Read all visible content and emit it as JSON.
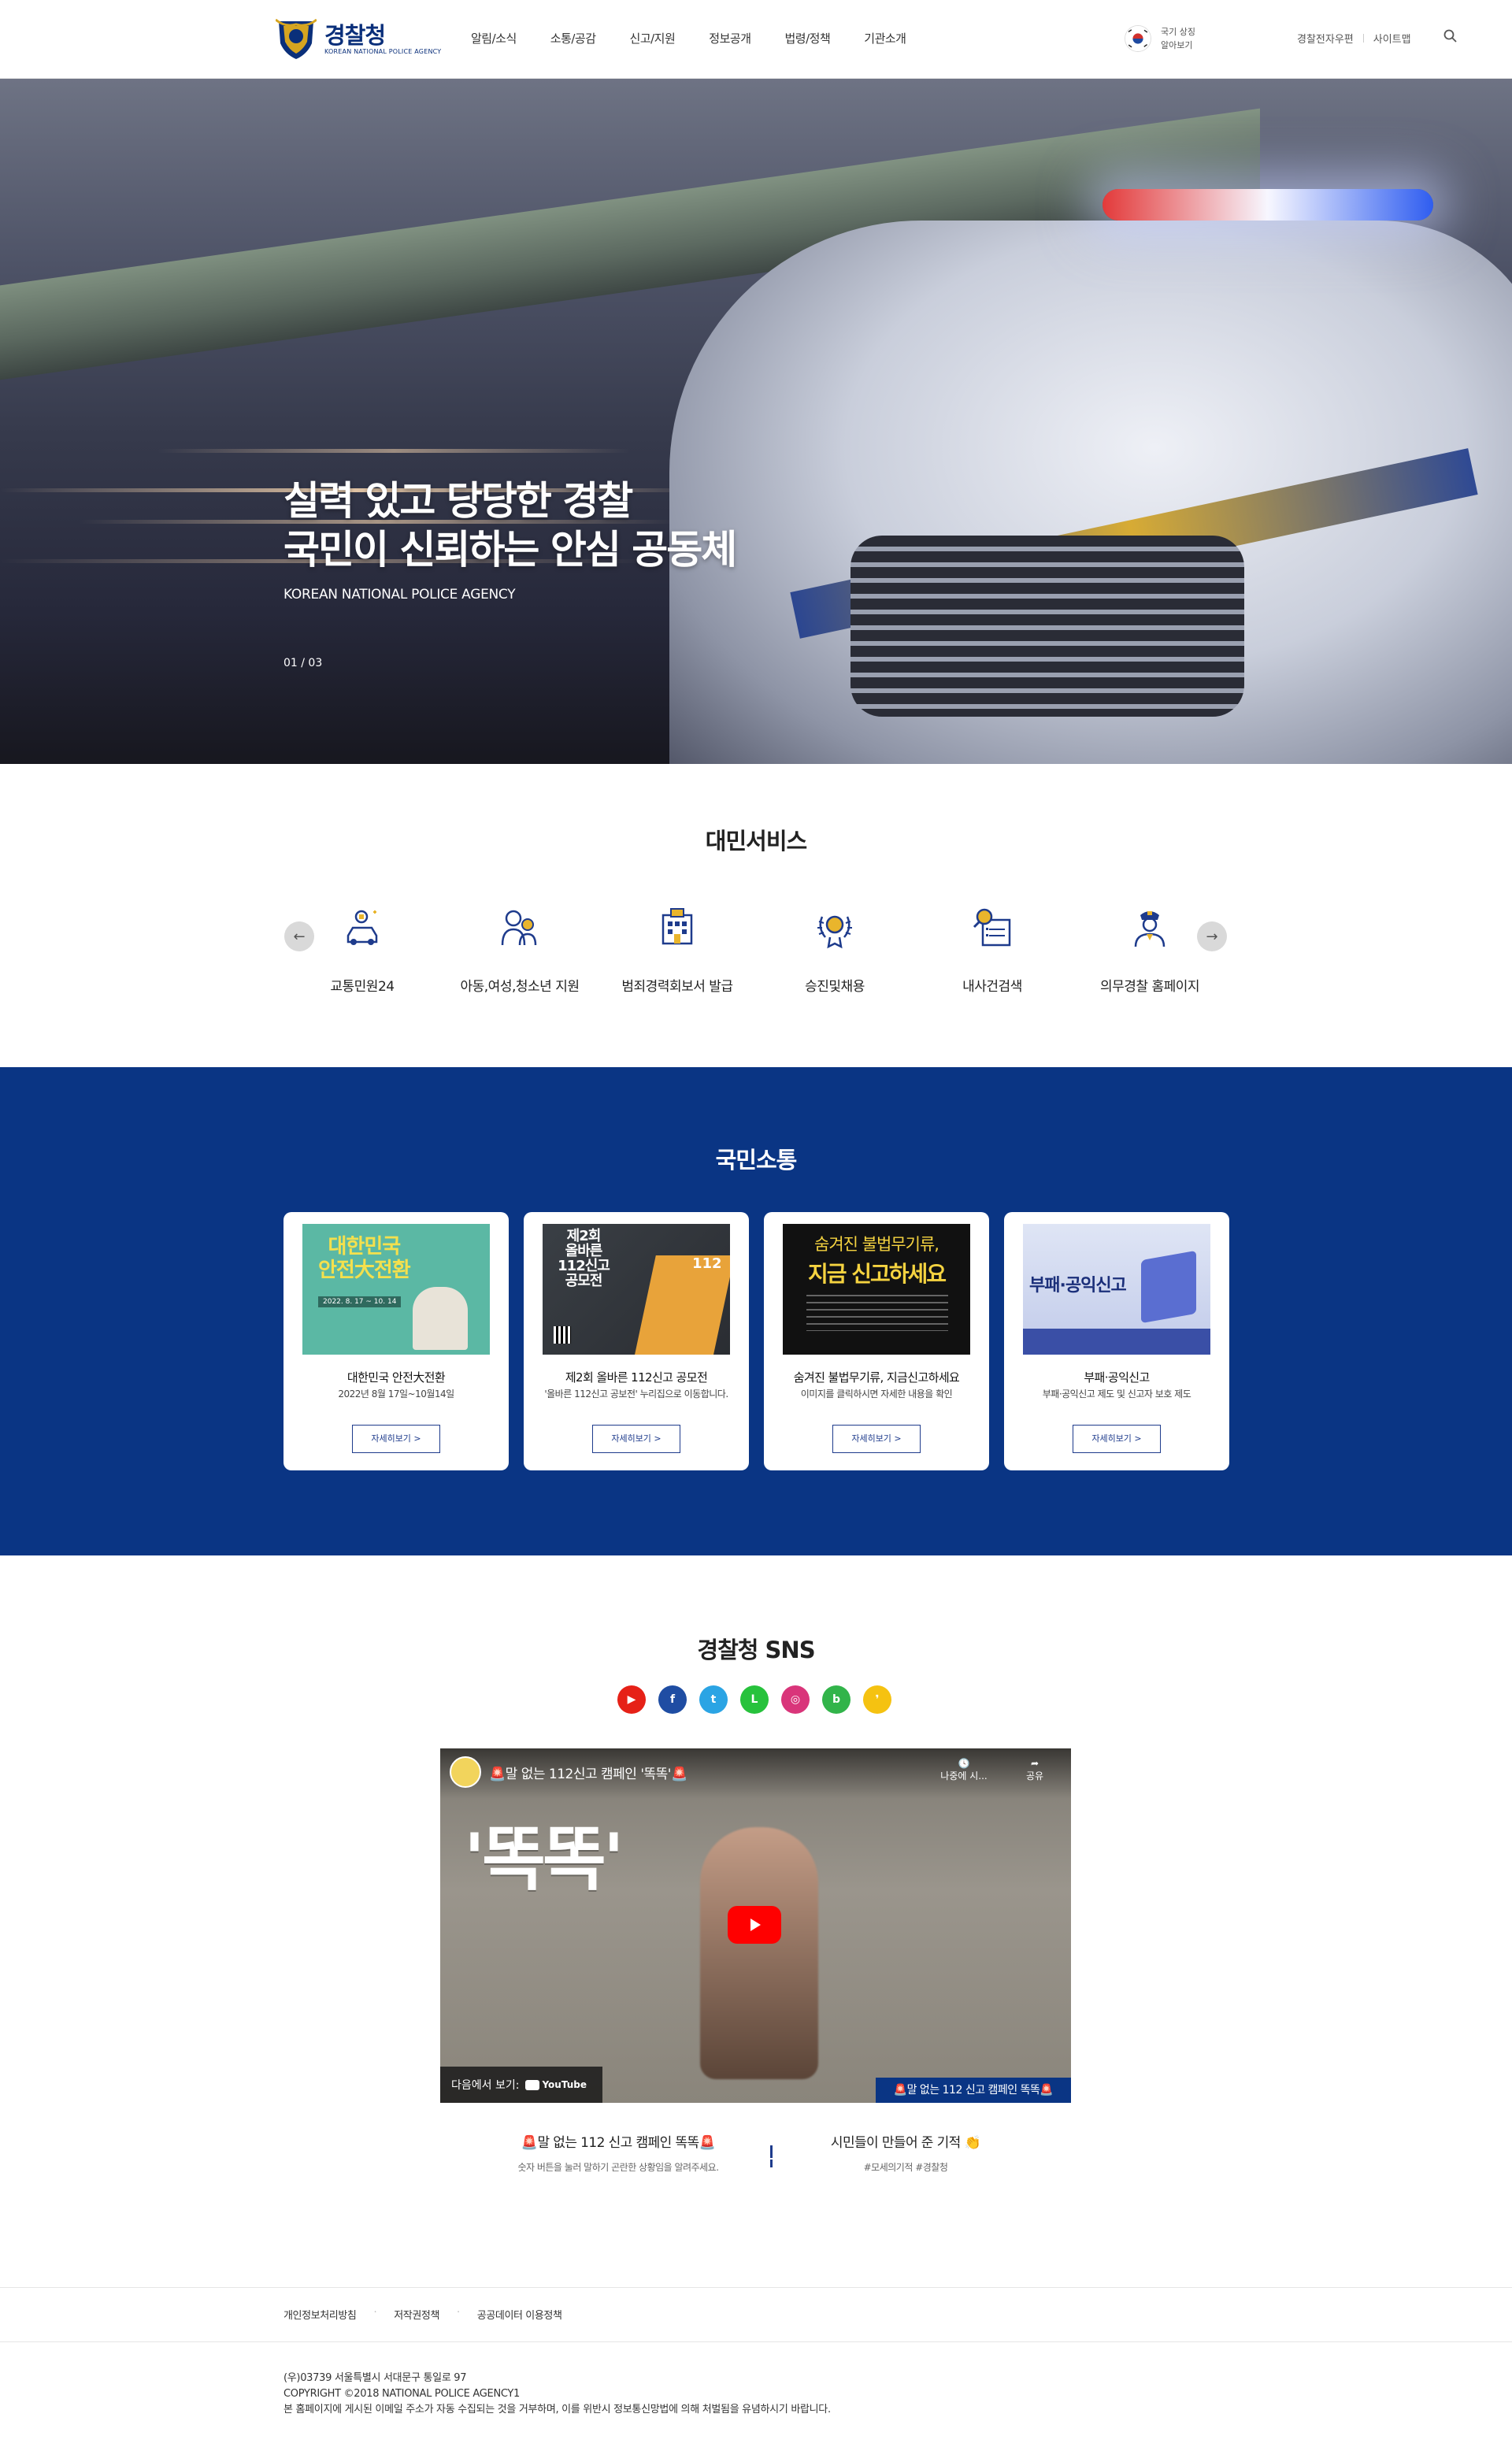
{
  "header": {
    "logo_ko": "경찰청",
    "logo_en": "KOREAN NATIONAL POLICE AGENCY",
    "nav": [
      "알림/소식",
      "소통/공감",
      "신고/지원",
      "정보공개",
      "법령/정책",
      "기관소개"
    ],
    "flag_label_1": "국기 상징",
    "flag_label_2": "알아보기",
    "util_links": [
      "경찰전자우편",
      "사이트맵"
    ],
    "search_icon": "search-icon"
  },
  "hero": {
    "title_line1": "실력 있고 당당한 경찰",
    "title_line2": "국민이 신뢰하는 안심 공동체",
    "subtitle": "KOREAN NATIONAL POLICE AGENCY",
    "counter": "01 / 03",
    "current_slide": 1,
    "total_slides": 3
  },
  "services": {
    "title": "대민서비스",
    "prev_icon": "arrow-left-icon",
    "next_icon": "arrow-right-icon",
    "items": [
      {
        "label": "교통민원24",
        "icon": "traffic-car-icon"
      },
      {
        "label": "아동,여성,청소년 지원",
        "icon": "family-icon"
      },
      {
        "label": "범죄경력회보서 발급",
        "icon": "document-building-icon"
      },
      {
        "label": "승진및채용",
        "icon": "badge-laurel-icon"
      },
      {
        "label": "내사건검색",
        "icon": "search-document-icon"
      },
      {
        "label": "의무경찰 홈페이지",
        "icon": "police-officer-icon"
      }
    ]
  },
  "communication": {
    "title": "국민소통",
    "cards": [
      {
        "title": "대한민국 안전大전환",
        "desc": "2022년 8월 17일~10월14일",
        "button": "자세히보기 >",
        "img_line1": "대한민국",
        "img_line2": "안전大전환",
        "img_date": "2022. 8. 17 ~ 10. 14"
      },
      {
        "title": "제2회 올바른 112신고 공모전",
        "desc": "'올바른 112신고 공보전' 누리집으로 이동합니다.",
        "button": "자세히보기 >",
        "img_line1": "제2회",
        "img_line2": "올바른",
        "img_line3": "112신고",
        "img_line4": "공모전",
        "img_num": "112"
      },
      {
        "title": "숨겨진 불법무기류, 지금신고하세요",
        "desc": "이미지를 클릭하시면 자세한 내용을 확인",
        "button": "자세히보기 >",
        "img_line1": "숨겨진 불법무기류,",
        "img_line2": "지금 신고하세요"
      },
      {
        "title": "부패·공익신고",
        "desc": "부패·공익신고 제도 및 신고자 보호 제도",
        "button": "자세히보기 >",
        "img_line1": "부패·공익신고"
      }
    ]
  },
  "sns": {
    "title": "경찰청 SNS",
    "icons": [
      {
        "name": "youtube-icon",
        "color": "#e62117",
        "glyph": "▶"
      },
      {
        "name": "facebook-icon",
        "color": "#1f4da3",
        "glyph": "f"
      },
      {
        "name": "twitter-icon",
        "color": "#2ba4e4",
        "glyph": "t"
      },
      {
        "name": "line-icon",
        "color": "#27c23c",
        "glyph": "L"
      },
      {
        "name": "instagram-icon",
        "color": "#d9357a",
        "glyph": "◎"
      },
      {
        "name": "band-icon",
        "color": "#32b44a",
        "glyph": "b"
      },
      {
        "name": "kakao-icon",
        "color": "#f5c211",
        "glyph": "❜"
      }
    ],
    "video": {
      "title": "🚨말 없는 112신고 캠페인 '똑똑'🚨",
      "big_text": "'똑똑'",
      "later": "나중에 시...",
      "share": "공유",
      "watch_on": "다음에서 보기:",
      "youtube": "YouTube",
      "tag": "🚨말 없는 112 신고 캠페인 똑똑🚨"
    },
    "left": {
      "title": "🚨말 없는 112 신고 캠페인 똑똑🚨",
      "desc": "숫자 버튼을 눌러 말하기 곤란한 상황임을 알려주세요."
    },
    "right": {
      "title": "시민들이 만들어 준 기적 👏",
      "desc": "#모세의기적 #경찰청"
    }
  },
  "footer": {
    "links": [
      "개인정보처리방침",
      "저작권정책",
      "공공데이터 이용정책"
    ],
    "address": "(우)03739 서울특별시 서대문구 통일로 97",
    "copyright": "COPYRIGHT ©2018 NATIONAL POLICE AGENCY1",
    "notice": "본 홈페이지에 게시된 이메일 주소가 자동 수집되는 것을 거부하며, 이를 위반시 정보통신망법에 의해 처벌됨을 유념하시기 바랍니다."
  }
}
